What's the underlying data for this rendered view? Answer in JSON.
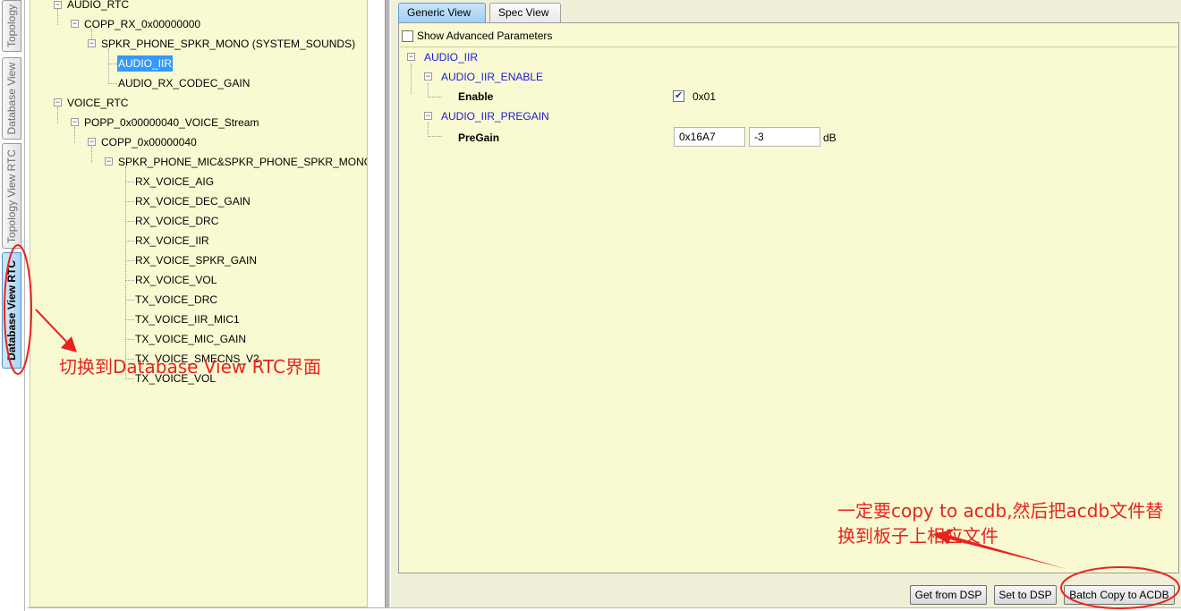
{
  "side_tabs": [
    {
      "label": "Topology"
    },
    {
      "label": "Database View"
    },
    {
      "label": "Topology View RTC"
    },
    {
      "label": "Database View RTC",
      "active": true
    }
  ],
  "tree": {
    "nodes": [
      {
        "label": "AUDIO_RTC"
      },
      {
        "label": "COPP_RX_0x00000000"
      },
      {
        "label": "SPKR_PHONE_SPKR_MONO (SYSTEM_SOUNDS)"
      },
      {
        "label": "AUDIO_IIR",
        "selected": true
      },
      {
        "label": "AUDIO_RX_CODEC_GAIN"
      },
      {
        "label": "VOICE_RTC"
      },
      {
        "label": "POPP_0x00000040_VOICE_Stream"
      },
      {
        "label": "COPP_0x00000040"
      },
      {
        "label": "SPKR_PHONE_MIC&SPKR_PHONE_SPKR_MONO"
      },
      {
        "label": "RX_VOICE_AIG"
      },
      {
        "label": "RX_VOICE_DEC_GAIN"
      },
      {
        "label": "RX_VOICE_DRC"
      },
      {
        "label": "RX_VOICE_IIR"
      },
      {
        "label": "RX_VOICE_SPKR_GAIN"
      },
      {
        "label": "RX_VOICE_VOL"
      },
      {
        "label": "TX_VOICE_DRC"
      },
      {
        "label": "TX_VOICE_IIR_MIC1"
      },
      {
        "label": "TX_VOICE_MIC_GAIN"
      },
      {
        "label": "TX_VOICE_SMECNS_V2"
      },
      {
        "label": "TX_VOICE_VOL"
      }
    ]
  },
  "view_tabs": [
    {
      "label": "Generic View",
      "active": true
    },
    {
      "label": "Spec View"
    }
  ],
  "show_advanced": {
    "label": "Show Advanced Parameters",
    "checked": false
  },
  "params": {
    "root": "AUDIO_IIR",
    "enable_group": "AUDIO_IIR_ENABLE",
    "enable_label": "Enable",
    "enable_checked": true,
    "enable_value": "0x01",
    "pregain_group": "AUDIO_IIR_PREGAIN",
    "pregain_label": "PreGain",
    "pregain_hex": "0x16A7",
    "pregain_db": "-3",
    "pregain_unit": "dB"
  },
  "buttons": {
    "get_from_dsp": "Get from DSP",
    "set_to_dsp": "Set to DSP",
    "batch_copy": "Batch Copy to ACDB"
  },
  "annotations": {
    "switch_note": "切换到Database View RTC界面",
    "copy_note_line1": "一定要copy to acdb,然后把acdb文件替",
    "copy_note_line2": "换到板子上相应文件"
  },
  "colors": {
    "panel_bg": "#fafad2",
    "selection": "#3399ff",
    "param_blue": "#1a1ad6",
    "annotation_red": "#e8231d"
  }
}
